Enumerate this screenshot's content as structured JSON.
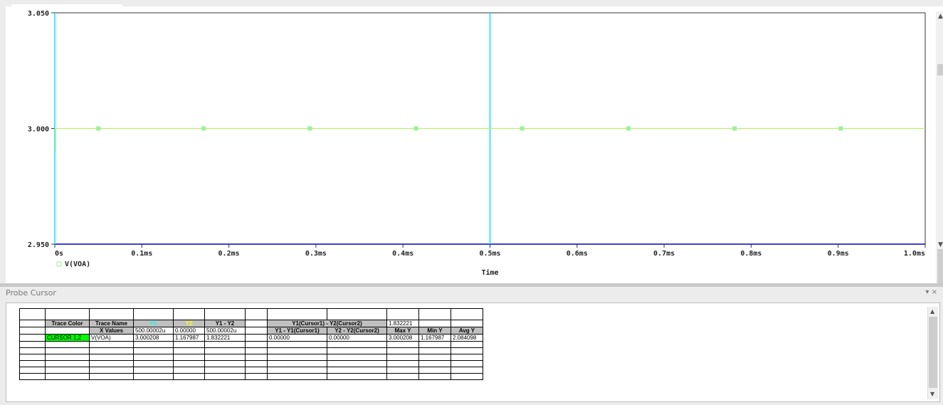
{
  "plot": {
    "y_ticks": [
      {
        "value": 3.05,
        "label": "3.050"
      },
      {
        "value": 3.0,
        "label": "3.000"
      },
      {
        "value": 2.95,
        "label": "2.950"
      }
    ],
    "x_ticks": [
      {
        "value": 0.0,
        "label": "0s"
      },
      {
        "value": 0.1,
        "label": "0.1ms"
      },
      {
        "value": 0.2,
        "label": "0.2ms"
      },
      {
        "value": 0.3,
        "label": "0.3ms"
      },
      {
        "value": 0.4,
        "label": "0.4ms"
      },
      {
        "value": 0.5,
        "label": "0.5ms"
      },
      {
        "value": 0.6,
        "label": "0.6ms"
      },
      {
        "value": 0.7,
        "label": "0.7ms"
      },
      {
        "value": 0.8,
        "label": "0.8ms"
      },
      {
        "value": 0.9,
        "label": "0.9ms"
      },
      {
        "value": 1.0,
        "label": "1.0ms"
      }
    ],
    "xlabel": "Time",
    "legend_label": "V(VOA)",
    "colors": {
      "trace": "#b6f26a",
      "marker": "#9cf09c",
      "cursor": "#00e5ff",
      "axis": "#0000cc",
      "frame": "#333333"
    }
  },
  "chart_data": {
    "type": "line",
    "series": [
      {
        "name": "V(VOA)",
        "x": [
          0.0,
          1.0
        ],
        "y": [
          3.0,
          3.0
        ],
        "marker_x": [
          0.05,
          0.171,
          0.293,
          0.415,
          0.537,
          0.659,
          0.781,
          0.903
        ]
      }
    ],
    "xlabel": "Time",
    "x_unit": "ms",
    "xlim": [
      0,
      1.0
    ],
    "ylim": [
      2.95,
      3.05
    ],
    "grid": false,
    "cursors": [
      0.0,
      0.5
    ]
  },
  "probe": {
    "title": "Probe Cursor",
    "controls": "▾ ×",
    "row1": {
      "trace_color": "Trace Color",
      "trace_name": "Trace Name",
      "y1": "Y1",
      "y2": "Y2",
      "y1_minus_y2": "Y1 - Y2",
      "cursor_diff_label": "Y1(Cursor1) - Y2(Cursor2)",
      "cursor_diff_value": "1.832221"
    },
    "row2": {
      "x_values": "X Values",
      "x1": "500.00002u",
      "x2": "0.00000",
      "x_diff": "500.00002u",
      "y1_minus_y1c": "Y1 - Y1(Cursor1)",
      "y2_minus_y2c": "Y2 - Y2(Cursor2)",
      "max_y": "Max Y",
      "min_y": "Min Y",
      "avg_y": "Avg Y"
    },
    "row3": {
      "cursor": "CURSOR 1,2",
      "name": "V(VOA)",
      "y1": "3.000208",
      "y2": "1.167987",
      "diff": "1.832221",
      "d1": "0.00000",
      "d2": "0.00000",
      "max": "3.000208",
      "min": "1.167987",
      "avg": "2.084098"
    }
  }
}
